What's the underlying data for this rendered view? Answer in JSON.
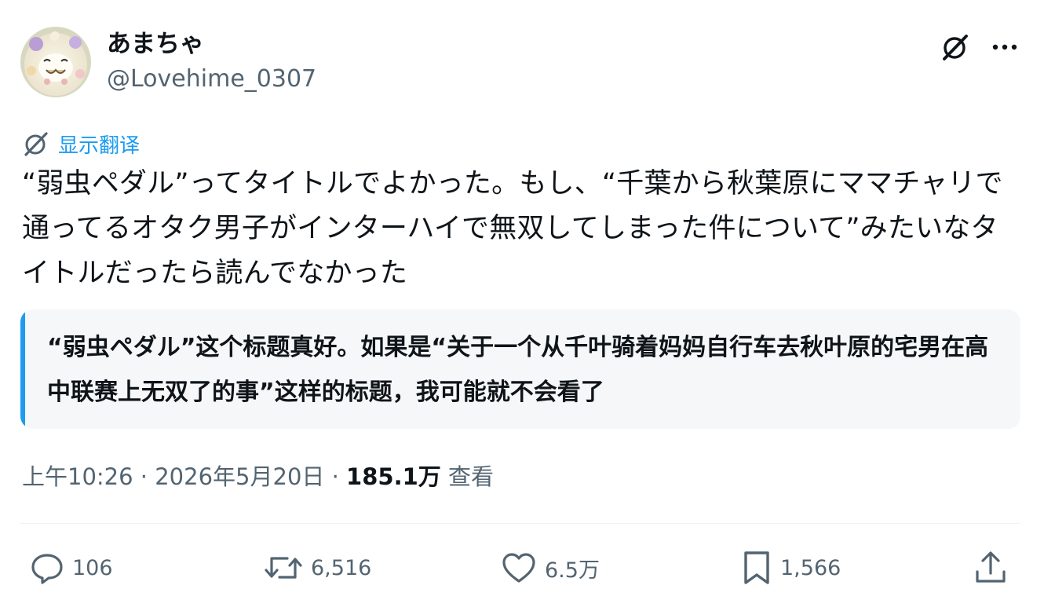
{
  "author": {
    "name": "あまちゃ",
    "handle": "@Lovehime_0307"
  },
  "icons": {
    "grok": "grok-icon",
    "more": "more-dots-icon",
    "translate": "translate-icon",
    "reply": "reply-bubble-icon",
    "repost": "repost-arrows-icon",
    "like": "heart-icon",
    "bookmark": "bookmark-icon",
    "share": "share-upload-icon"
  },
  "translate_label": "显示翻译",
  "tweet_text": "“弱虫ペダル”ってタイトルでよかった。もし、“千葉から秋葉原にママチャリで通ってるオタク男子がインターハイで無双してしまった件について”みたいなタイトルだったら読んでなかった",
  "translation_text": "“弱虫ペダル”这个标题真好。如果是“关于一个从千叶骑着妈妈自行车去秋叶原的宅男在高中联赛上无双了的事”这样的标题，我可能就不会看了",
  "meta": {
    "time": "上午10:26",
    "sep1": " · ",
    "date": "2026年5月20日",
    "sep2": " · ",
    "views_count": "185.1万",
    "views_label": " 查看"
  },
  "actions": {
    "replies": "106",
    "reposts": "6,516",
    "likes": "6.5万",
    "bookmarks": "1,566"
  },
  "colors": {
    "accent": "#1d9bf0",
    "text": "#0f1419",
    "secondary": "#536471",
    "quote_bg": "#f5f7f9"
  }
}
